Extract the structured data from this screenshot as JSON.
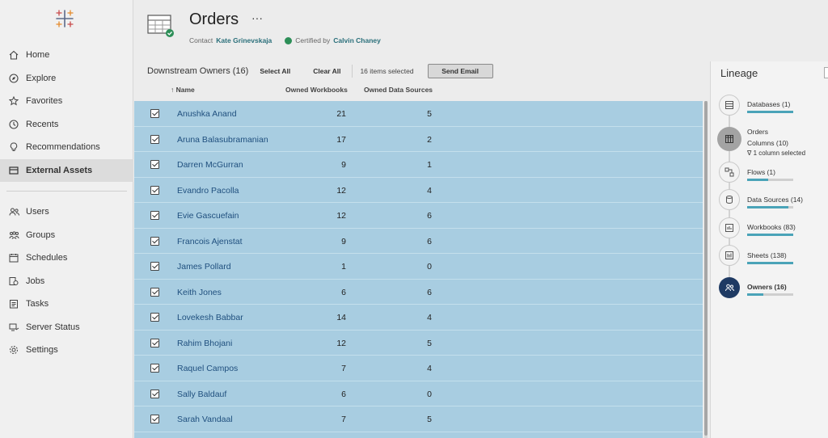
{
  "sidebar": {
    "items": [
      {
        "label": "Home",
        "icon": "home-icon"
      },
      {
        "label": "Explore",
        "icon": "compass-icon"
      },
      {
        "label": "Favorites",
        "icon": "star-icon"
      },
      {
        "label": "Recents",
        "icon": "clock-icon"
      },
      {
        "label": "Recommendations",
        "icon": "bulb-icon"
      },
      {
        "label": "External Assets",
        "icon": "external-assets-icon",
        "active": true
      }
    ],
    "admin_items": [
      {
        "label": "Users",
        "icon": "users-icon"
      },
      {
        "label": "Groups",
        "icon": "groups-icon"
      },
      {
        "label": "Schedules",
        "icon": "calendar-icon"
      },
      {
        "label": "Jobs",
        "icon": "jobs-icon"
      },
      {
        "label": "Tasks",
        "icon": "tasks-icon"
      },
      {
        "label": "Server Status",
        "icon": "server-status-icon"
      },
      {
        "label": "Settings",
        "icon": "gear-icon"
      }
    ]
  },
  "header": {
    "title": "Orders",
    "more": "···",
    "contact_label": "Contact",
    "contact_name": "Kate Grinevskaja",
    "certified_label": "Certified by",
    "certified_name": "Calvin Chaney"
  },
  "toolbar": {
    "title": "Downstream Owners (16)",
    "select_all": "Select All",
    "clear_all": "Clear All",
    "selected_count": "16 items selected",
    "send_email": "Send Email"
  },
  "table": {
    "columns": {
      "name": "↑ Name",
      "workbooks": "Owned Workbooks",
      "data_sources": "Owned Data Sources"
    },
    "rows": [
      {
        "name": "Anushka Anand",
        "workbooks": "21",
        "data_sources": "5"
      },
      {
        "name": "Aruna Balasubramanian",
        "workbooks": "17",
        "data_sources": "2"
      },
      {
        "name": "Darren McGurran",
        "workbooks": "9",
        "data_sources": "1"
      },
      {
        "name": "Evandro Pacolla",
        "workbooks": "12",
        "data_sources": "4"
      },
      {
        "name": "Evie Gascuefain",
        "workbooks": "12",
        "data_sources": "6"
      },
      {
        "name": "Francois Ajenstat",
        "workbooks": "9",
        "data_sources": "6"
      },
      {
        "name": "James Pollard",
        "workbooks": "1",
        "data_sources": "0"
      },
      {
        "name": "Keith Jones",
        "workbooks": "6",
        "data_sources": "6"
      },
      {
        "name": "Lovekesh Babbar",
        "workbooks": "14",
        "data_sources": "4"
      },
      {
        "name": "Rahim Bhojani",
        "workbooks": "12",
        "data_sources": "5"
      },
      {
        "name": "Raquel Campos",
        "workbooks": "7",
        "data_sources": "4"
      },
      {
        "name": "Sally Baldauf",
        "workbooks": "6",
        "data_sources": "0"
      },
      {
        "name": "Sarah Vandaal",
        "workbooks": "7",
        "data_sources": "5"
      },
      {
        "name": "",
        "workbooks": "",
        "data_sources": ""
      }
    ]
  },
  "lineage": {
    "title": "Lineage",
    "nodes": [
      {
        "label": "Databases (1)",
        "icon": "database-icon",
        "fill": 1.0
      },
      {
        "label": "Orders",
        "sub": "Columns (10)",
        "filter": "1 column selected",
        "icon": "table-icon"
      },
      {
        "label": "Flows (1)",
        "icon": "flow-icon",
        "fill": 0.45
      },
      {
        "label": "Data Sources (14)",
        "icon": "datasource-icon",
        "fill": 0.9
      },
      {
        "label": "Workbooks (83)",
        "icon": "workbook-icon",
        "fill": 1.0
      },
      {
        "label": "Sheets (138)",
        "icon": "sheet-icon",
        "fill": 1.0
      },
      {
        "label": "Owners (16)",
        "icon": "owners-icon",
        "fill": 0.35
      }
    ]
  },
  "colors": {
    "row_selected": "#a8cde1",
    "link_name": "#1f4f7e",
    "accent_teal": "#2a6f7a",
    "lineage_dark": "#1f3a63"
  }
}
